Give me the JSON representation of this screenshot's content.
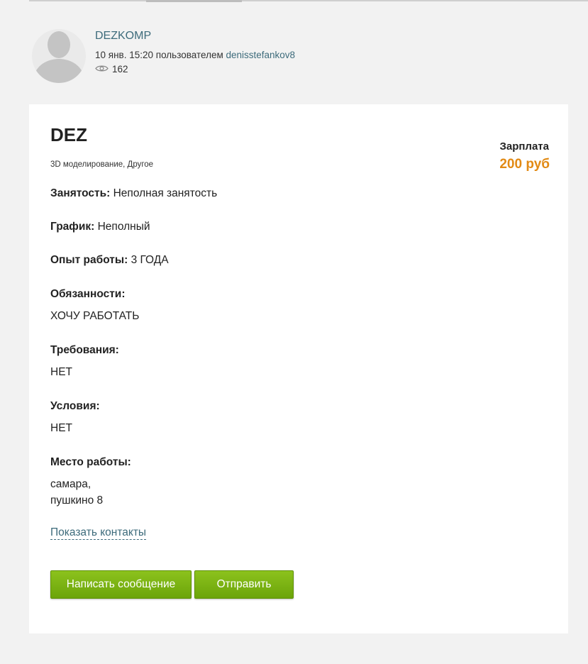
{
  "post": {
    "author": "DEZKOMP",
    "date": "10 янв. 15:20",
    "by_text": "пользователем",
    "user": "denisstefankov8",
    "views": "162"
  },
  "vacancy": {
    "title": "DEZ",
    "categories": "3D моделирование, Другое",
    "salary_label": "Зарплата",
    "salary_value": "200 руб",
    "employment_label": "Занятость:",
    "employment_value": "Неполная занятость",
    "schedule_label": "График:",
    "schedule_value": "Неполный",
    "experience_label": "Опыт работы:",
    "experience_value": "3 ГОДА",
    "duties_label": "Обязанности:",
    "duties_value": "ХОЧУ РАБОТАТЬ",
    "requirements_label": "Требования:",
    "requirements_value": "НЕТ",
    "conditions_label": "Условия:",
    "conditions_value": "НЕТ",
    "workplace_label": "Место работы:",
    "workplace_line1": "самара,",
    "workplace_line2": "пушкино 8"
  },
  "actions": {
    "show_contacts": "Показать контакты",
    "write_message": "Написать сообщение",
    "send": "Отправить"
  },
  "colors": {
    "link": "#3d6b7b",
    "salary": "#e28a14",
    "button": "#7cb412"
  },
  "icons": {
    "avatar": "user-silhouette",
    "views": "eye-icon"
  }
}
